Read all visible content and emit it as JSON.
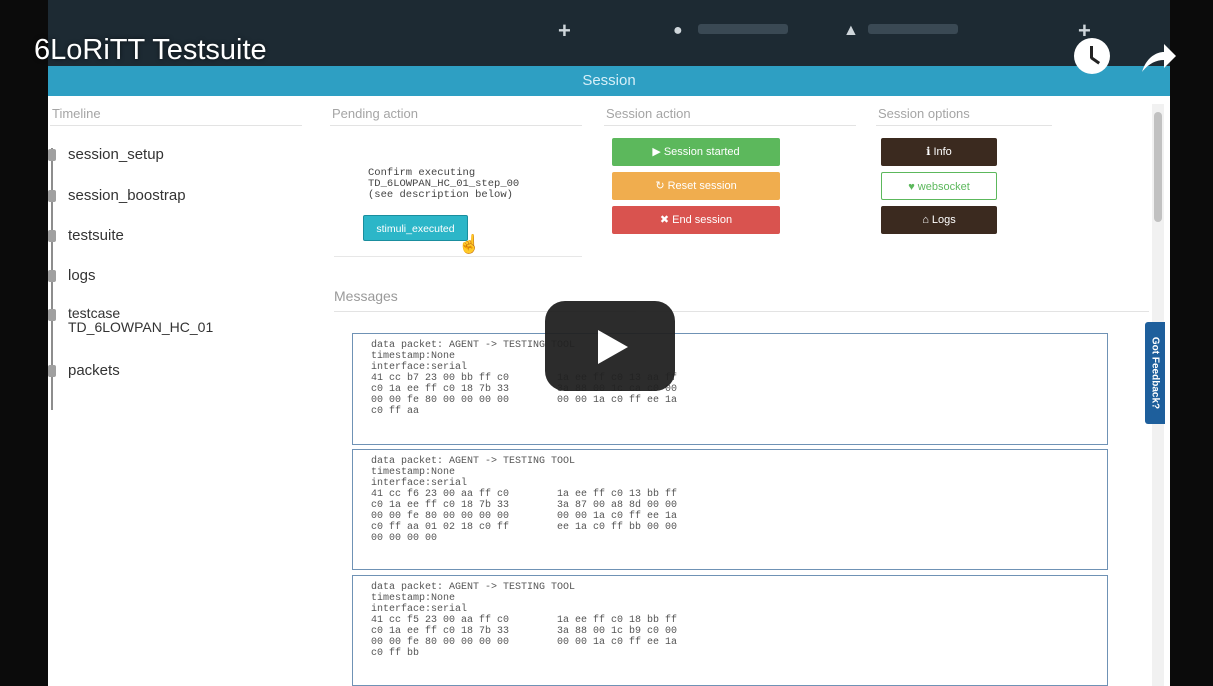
{
  "video": {
    "title": "6LoRiTT Testsuite"
  },
  "navbar": {
    "icons": [
      "plus-icon",
      "globe-icon",
      "user-icon",
      "plus-icon"
    ]
  },
  "session_bar": {
    "title": "Session"
  },
  "sections": {
    "timeline": "Timeline",
    "pending": "Pending action",
    "session_action": "Session action",
    "session_options": "Session options",
    "messages": "Messages"
  },
  "timeline": {
    "items": [
      {
        "label": "session_setup"
      },
      {
        "label": "session_boostrap"
      },
      {
        "label": "testsuite"
      },
      {
        "label": "logs"
      },
      {
        "label": "testcase\nTD_6LOWPAN_HC_01"
      },
      {
        "label": "packets"
      }
    ]
  },
  "pending_action": {
    "message": "Confirm executing\nTD_6LOWPAN_HC_01_step_00\n(see description below)",
    "button": "stimuli_executed"
  },
  "session_action": {
    "start": "Session started",
    "reset": "Reset session",
    "end": "End session"
  },
  "session_options": {
    "info": "Info",
    "websocket": "websocket",
    "logs": "Logs"
  },
  "feedback": {
    "label": "Got Feedback?"
  },
  "messages": [
    {
      "title": "data packet: AGENT -> TESTING TOOL",
      "lines": [
        "timestamp:None",
        "interface:serial",
        "41 cc b7 23 00 bb ff c0        1a ee ff c0 13 aa ff",
        "c0 1a ee ff c0 18 7b 33        3a 88 00 1c ca c0 00",
        "00 00 fe 80 00 00 00 00        00 00 1a c0 ff ee 1a",
        "c0 ff aa"
      ]
    },
    {
      "title": "data packet: AGENT -> TESTING TOOL",
      "lines": [
        "timestamp:None",
        "interface:serial",
        "41 cc f6 23 00 aa ff c0        1a ee ff c0 13 bb ff",
        "c0 1a ee ff c0 18 7b 33        3a 87 00 a8 8d 00 00",
        "00 00 fe 80 00 00 00 00        00 00 1a c0 ff ee 1a",
        "c0 ff aa 01 02 18 c0 ff        ee 1a c0 ff bb 00 00",
        "00 00 00 00"
      ]
    },
    {
      "title": "data packet: AGENT -> TESTING TOOL",
      "lines": [
        "timestamp:None",
        "interface:serial",
        "41 cc f5 23 00 aa ff c0        1a ee ff c0 18 bb ff",
        "c0 1a ee ff c0 18 7b 33        3a 88 00 1c b9 c0 00",
        "00 00 fe 80 00 00 00 00        00 00 1a c0 ff ee 1a",
        "c0 ff bb"
      ]
    }
  ]
}
